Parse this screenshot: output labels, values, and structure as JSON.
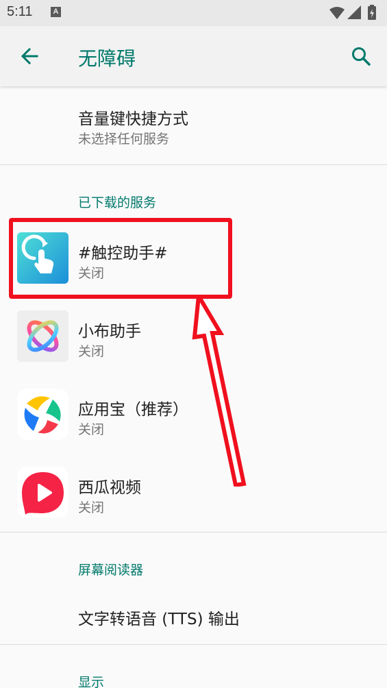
{
  "status_bar": {
    "time": "5:11",
    "notification_letter": "A"
  },
  "app_bar": {
    "title": "无障碍"
  },
  "volume_shortcut": {
    "title": "音量键快捷方式",
    "subtitle": "未选择任何服务"
  },
  "downloaded_services": {
    "header": "已下载的服务",
    "items": [
      {
        "title": "#触控助手#",
        "status": "关闭",
        "icon": "touch-assistant-icon"
      },
      {
        "title": "小布助手",
        "status": "关闭",
        "icon": "xiaobu-assistant-icon"
      },
      {
        "title": "应用宝（推荐）",
        "status": "关闭",
        "icon": "yingyongbao-icon"
      },
      {
        "title": "西瓜视频",
        "status": "关闭",
        "icon": "xigua-video-icon"
      }
    ]
  },
  "screen_readers": {
    "header": "屏幕阅读器",
    "tts_title": "文字转语音 (TTS) 输出"
  },
  "display": {
    "header": "显示"
  },
  "colors": {
    "accent": "#00796b",
    "highlight": "#f0101e"
  }
}
